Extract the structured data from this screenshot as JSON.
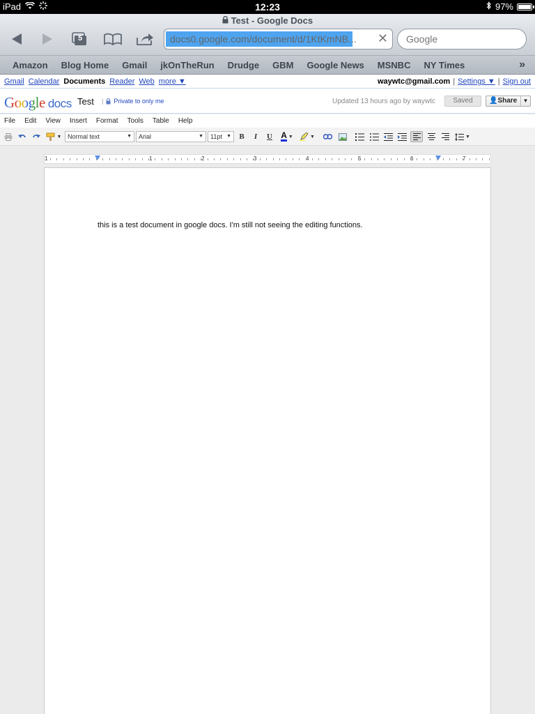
{
  "status": {
    "device": "iPad",
    "time": "12:23",
    "battery": "97%"
  },
  "browser": {
    "title": "Test - Google Docs",
    "tab_count": "5",
    "url": "docs0.google.com/document/d/1KtKmNB...",
    "search_placeholder": "Google"
  },
  "bookmarks": [
    "Amazon",
    "Blog Home",
    "Gmail",
    "jkOnTheRun",
    "Drudge",
    "GBM",
    "Google News",
    "MSNBC",
    "NY Times"
  ],
  "gbar": {
    "links": [
      "Gmail",
      "Calendar",
      "Documents",
      "Reader",
      "Web",
      "more ▼"
    ],
    "email": "waywtc@gmail.com",
    "settings": "Settings ▼",
    "signout": "Sign out"
  },
  "docs": {
    "logo_google": "Google",
    "logo_docs": "docs",
    "doc_title": "Test",
    "privacy": "Private to only me",
    "updated": "Updated 13 hours ago by waywtc",
    "saved_label": "Saved",
    "share_label": "Share"
  },
  "menu": [
    "File",
    "Edit",
    "View",
    "Insert",
    "Format",
    "Tools",
    "Table",
    "Help"
  ],
  "toolbar": {
    "style": "Normal text",
    "font": "Arial",
    "size": "11pt",
    "bold": "B",
    "italic": "I",
    "underline": "U",
    "text_color": "A"
  },
  "ruler": {
    "numbers": [
      "1",
      "1",
      "2",
      "3",
      "4",
      "5",
      "6",
      "7"
    ]
  },
  "document": {
    "text": "this is a test document in google docs. I'm still not seeing the editing functions."
  },
  "colors": {
    "link": "#2046bd",
    "url_selection": "#4ea4ef",
    "ruler_marker": "#5b8fe6"
  }
}
